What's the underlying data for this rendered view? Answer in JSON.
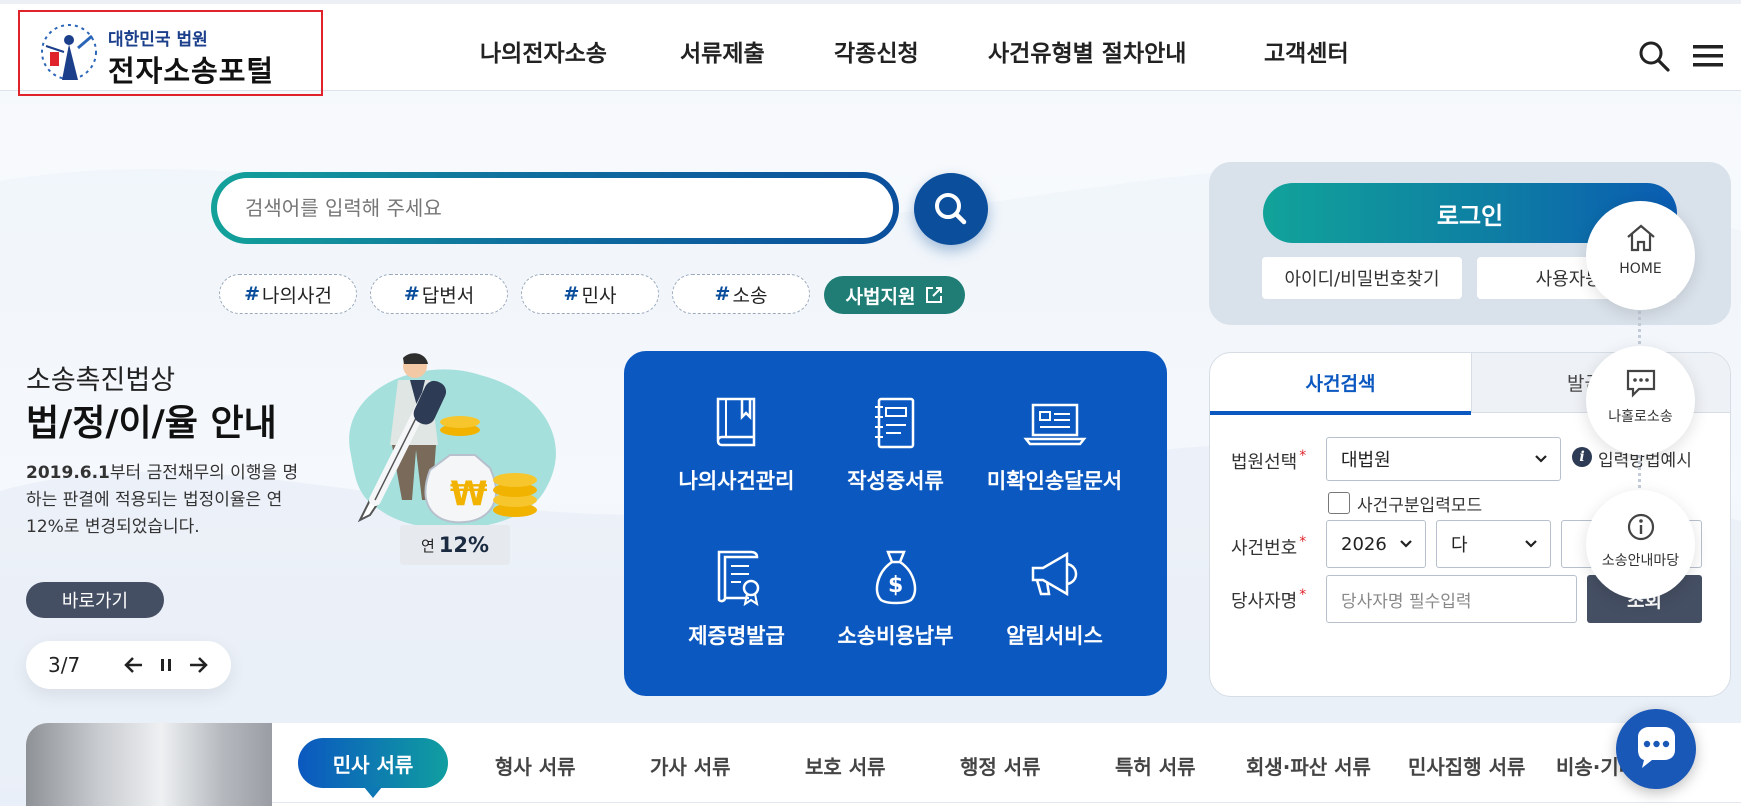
{
  "logo": {
    "small": "대한민국 법원",
    "big": "전자소송포털"
  },
  "nav": {
    "items": [
      "나의전자소송",
      "서류제출",
      "각종신청",
      "사건유형별 절차안내",
      "고객센터"
    ]
  },
  "header_icons": {
    "search": "search-icon",
    "menu": "hamburger-menu-icon"
  },
  "search": {
    "placeholder": "검색어를 입력해 주세요",
    "button_icon": "search-icon"
  },
  "tags": [
    "나의사건",
    "답변서",
    "민사",
    "소송"
  ],
  "tag_hash": "#",
  "law_support": {
    "label": "사법지원",
    "icon": "external-link-icon"
  },
  "banner": {
    "subtitle": "소송촉진법상",
    "title": "법/정/이/율 안내",
    "desc_bold": "2019.6.1",
    "desc_rest": "부터 금전채무의 이행을 명하는 판결에 적용되는 법정이율은 연12%로 변경되었습니다.",
    "rate_prefix": "연",
    "rate_value": "12%",
    "go_label": "바로가기",
    "pager": "3/7"
  },
  "services": [
    {
      "label": "나의사건관리",
      "icon": "book-icon"
    },
    {
      "label": "작성중서류",
      "icon": "notebook-icon"
    },
    {
      "label": "미확인송달문서",
      "icon": "laptop-icon"
    },
    {
      "label": "제증명발급",
      "icon": "certificate-icon"
    },
    {
      "label": "소송비용납부",
      "icon": "money-bag-icon"
    },
    {
      "label": "알림서비스",
      "icon": "megaphone-icon"
    }
  ],
  "login": {
    "button": "로그인",
    "find": "아이디/비밀번호찾기",
    "register": "사용자등록"
  },
  "case_search": {
    "tabs": [
      "사건검색",
      "발급문서"
    ],
    "court_label": "법원선택",
    "court_value": "대법원",
    "input_help": "입력방법예시",
    "mode_label": "사건구분입력모드",
    "case_no_label": "사건번호",
    "year_value": "2026",
    "type_value": "다",
    "party_label": "당사자명",
    "party_placeholder": "당사자명 필수입력",
    "lookup": "조회",
    "required_mark": "*"
  },
  "quick_menu": [
    {
      "label": "HOME",
      "icon": "home-icon"
    },
    {
      "label": "나홀로소송",
      "icon": "chat-bubble-icon"
    },
    {
      "label": "소송안내마당",
      "icon": "info-icon"
    }
  ],
  "chatbot_icon": "chatbot-icon",
  "doc_tabs": {
    "active": "민사 서류",
    "items": [
      "형사 서류",
      "가사 서류",
      "보호 서류",
      "행정 서류",
      "특허 서류",
      "회생·파산 서류",
      "민사집행 서류",
      "비송·기타 서류"
    ]
  },
  "colors": {
    "primary": "#0b58c0",
    "teal": "#11a39a",
    "dark": "#454f63",
    "highlight": "#e0232a"
  }
}
